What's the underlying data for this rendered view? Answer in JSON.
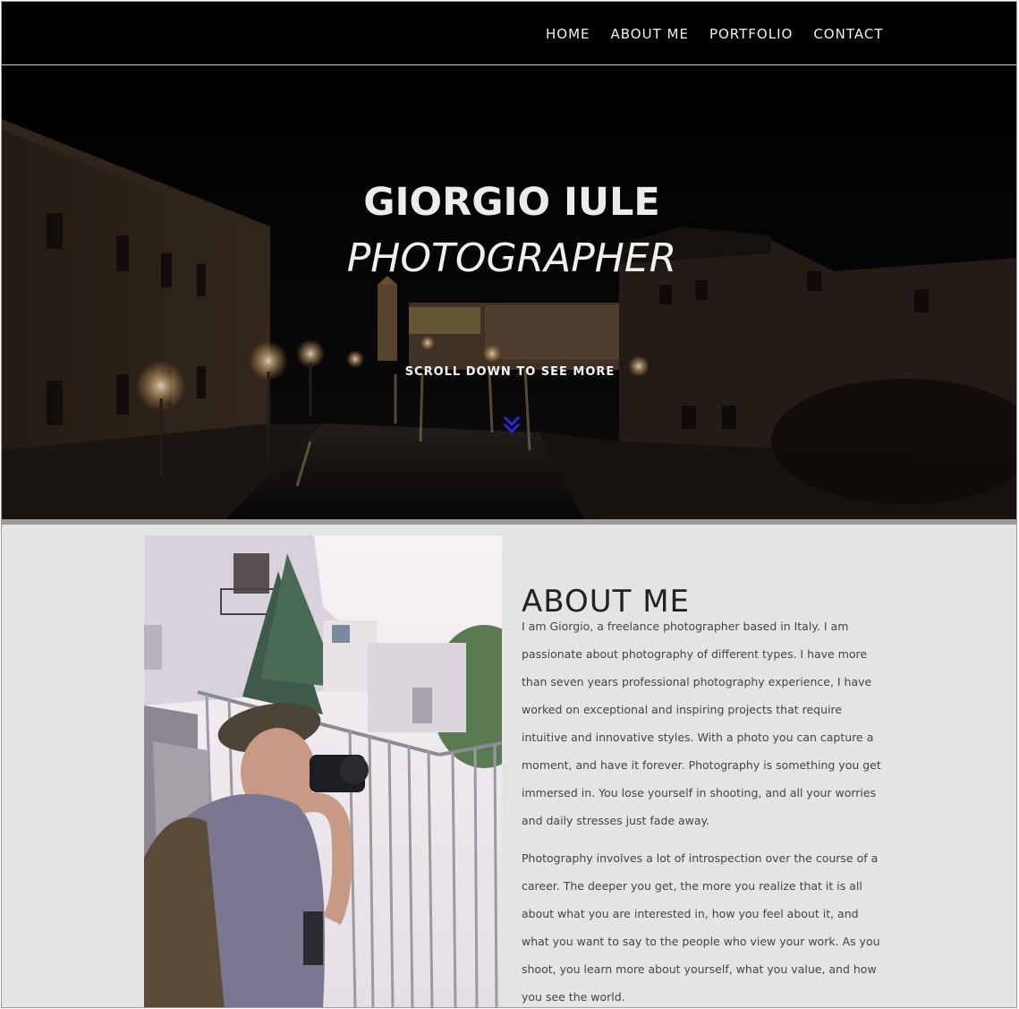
{
  "nav": {
    "items": [
      {
        "label": "HOME"
      },
      {
        "label": "ABOUT ME"
      },
      {
        "label": "PORTFOLIO"
      },
      {
        "label": "CONTACT"
      }
    ]
  },
  "hero": {
    "name": "GIORGIO IULE",
    "role": "PHOTOGRAPHER",
    "scroll_label": "SCROLL DOWN TO SEE MORE",
    "arrow_icon": "double-chevron-down-icon",
    "accent_color": "#2a2adc"
  },
  "about": {
    "title": "ABOUT ME",
    "paragraphs": [
      "I am Giorgio, a freelance photographer based in Italy. I am passionate about photography of different types. I have more than seven years professional photography experience, I have worked on exceptional and inspiring projects that require intuitive and innovative styles. With a photo you can capture a moment, and have it forever. Photography is something you get immersed in. You lose yourself in shooting, and all your worries and daily stresses just fade away.",
      "Photography involves a lot of introspection over the course of a career. The deeper you get, the more you realize that it is all about what you are interested in, how you feel about it, and what you want to say to the people who view your work. As you shoot, you learn more about yourself, what you value, and how you see the world."
    ]
  }
}
